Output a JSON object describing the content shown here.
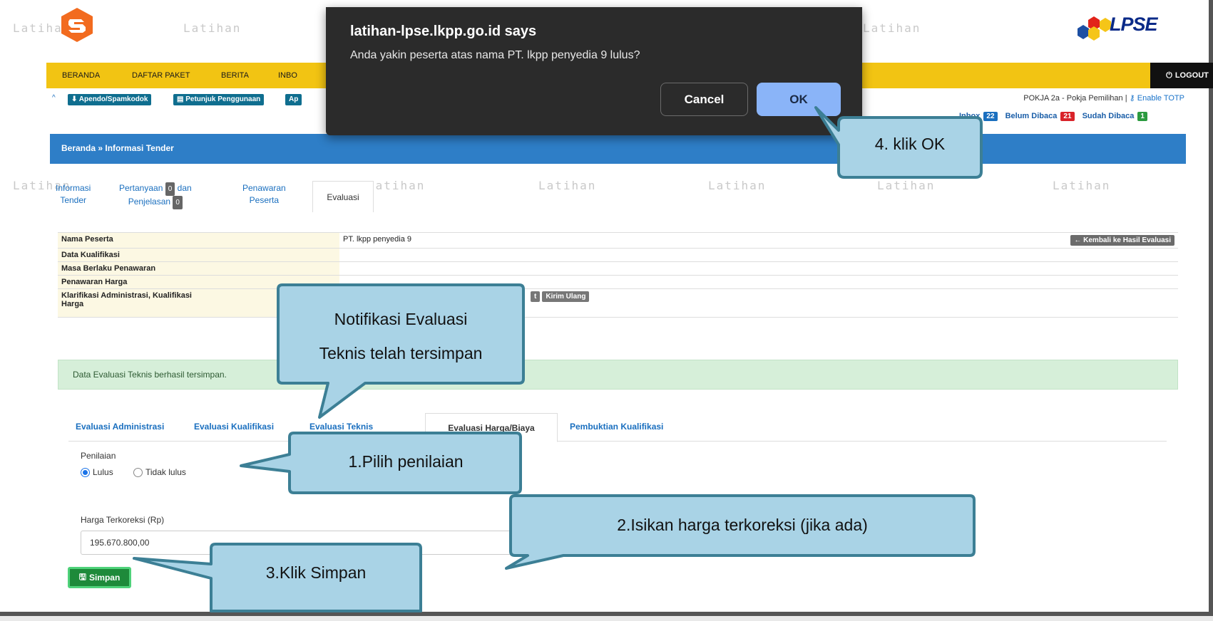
{
  "watermark": "Latihan",
  "brand": {
    "lpse_text": "LPSE"
  },
  "nav": {
    "items": [
      "BERANDA",
      "DAFTAR PAKET",
      "BERITA",
      "INBO"
    ],
    "logout": "LOGOUT"
  },
  "subbar": {
    "buttons": [
      "Apendo/Spamkodok",
      "Petunjuk Penggunaan",
      "Ap"
    ],
    "user": "POKJA 2a - Pokja Pemilihan |",
    "totp": "Enable TOTP",
    "inbox_label": "Inbox",
    "inbox_count": "22",
    "unread_label": "Belum Dibaca",
    "unread_count": "21",
    "read_label": "Sudah Dibaca",
    "read_count": "1"
  },
  "breadcrumb": "Beranda » Informasi Tender",
  "tabs": {
    "info_l1": "Informasi",
    "info_l2": "Tender",
    "tanya_l1": "Pertanyaan",
    "tanya_count": "0",
    "tanya_dan": "dan",
    "tanya_l2": "Penjelasan",
    "tanya_count2": "0",
    "penawaran_l1": "Penawaran",
    "penawaran_l2": "Peserta",
    "evaluasi": "Evaluasi"
  },
  "info_table": {
    "rows": [
      {
        "label": "Nama Peserta",
        "value": "PT. lkpp penyedia 9"
      },
      {
        "label": "Data Kualifikasi",
        "value": ""
      },
      {
        "label": "Masa Berlaku Penawaran",
        "value": ""
      },
      {
        "label": "Penawaran Harga",
        "value": ""
      },
      {
        "label": "Klarifikasi Administrasi, Kualifikasi",
        "label2": "Harga",
        "value": ""
      }
    ],
    "back_button": "← Kembali ke Hasil Evaluasi",
    "btn_partial": "t",
    "btn_kirim_ulang": "Kirim Ulang"
  },
  "alert": "Data Evaluasi Teknis berhasil tersimpan.",
  "eval_tabs": [
    "Evaluasi Administrasi",
    "Evaluasi Kualifikasi",
    "Evaluasi Teknis",
    "Evaluasi Harga/Biaya",
    "Pembuktian Kualifikasi"
  ],
  "form": {
    "penilaian_label": "Penilaian",
    "lulus": "Lulus",
    "tidak_lulus": "Tidak lulus",
    "selected": "Lulus",
    "harga_label": "Harga Terkoreksi (Rp)",
    "harga_value": "195.670.800,00",
    "simpan": "Simpan"
  },
  "dialog": {
    "title": "latihan-lpse.lkpp.go.id says",
    "message": "Anda yakin peserta atas nama PT. lkpp penyedia 9 lulus?",
    "cancel": "Cancel",
    "ok": "OK"
  },
  "callouts": {
    "ok": "4. klik OK",
    "notif_l1": "Notifikasi Evaluasi",
    "notif_l2": "Teknis telah tersimpan",
    "pilih": "1.Pilih penilaian",
    "harga": "2.Isikan harga  terkoreksi (jika ada)",
    "simpan": "3.Klik Simpan"
  },
  "colors": {
    "nav_yellow": "#f2c413",
    "breadcrumb_blue": "#2e7ec7",
    "callout_fill": "#a9d3e6",
    "callout_stroke": "#3c7f95",
    "ok_blue": "#8ab4f8"
  }
}
